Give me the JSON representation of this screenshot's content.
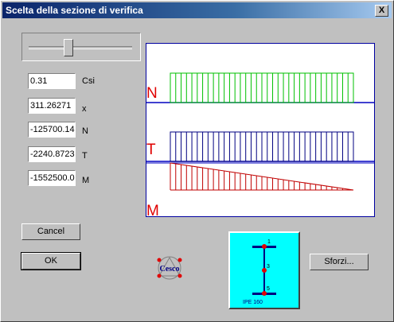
{
  "window": {
    "title": "Scelta della sezione di verifica",
    "close_label": "X"
  },
  "slider": {
    "value_fraction": 0.38
  },
  "fields": [
    {
      "value": "0.31",
      "label": "Csi"
    },
    {
      "value": "311.26271",
      "label": "x"
    },
    {
      "value": "-125700.14",
      "label": "N"
    },
    {
      "value": "-2240.8723",
      "label": "T"
    },
    {
      "value": "-1552500.0",
      "label": "M"
    }
  ],
  "buttons": {
    "cancel": "Cancel",
    "ok": "OK",
    "sforzi": "Sforzi..."
  },
  "diagrams": {
    "labels": {
      "n": "N",
      "t": "T",
      "m": "M"
    },
    "colors": {
      "n": "#00c000",
      "t": "#000080",
      "m": "#c00000",
      "axis": "#0000c0",
      "label": "#e00000"
    }
  },
  "section": {
    "name": "IPE 160",
    "points": [
      "1",
      "3",
      "5"
    ]
  },
  "logo": {
    "text": "Cesco"
  }
}
